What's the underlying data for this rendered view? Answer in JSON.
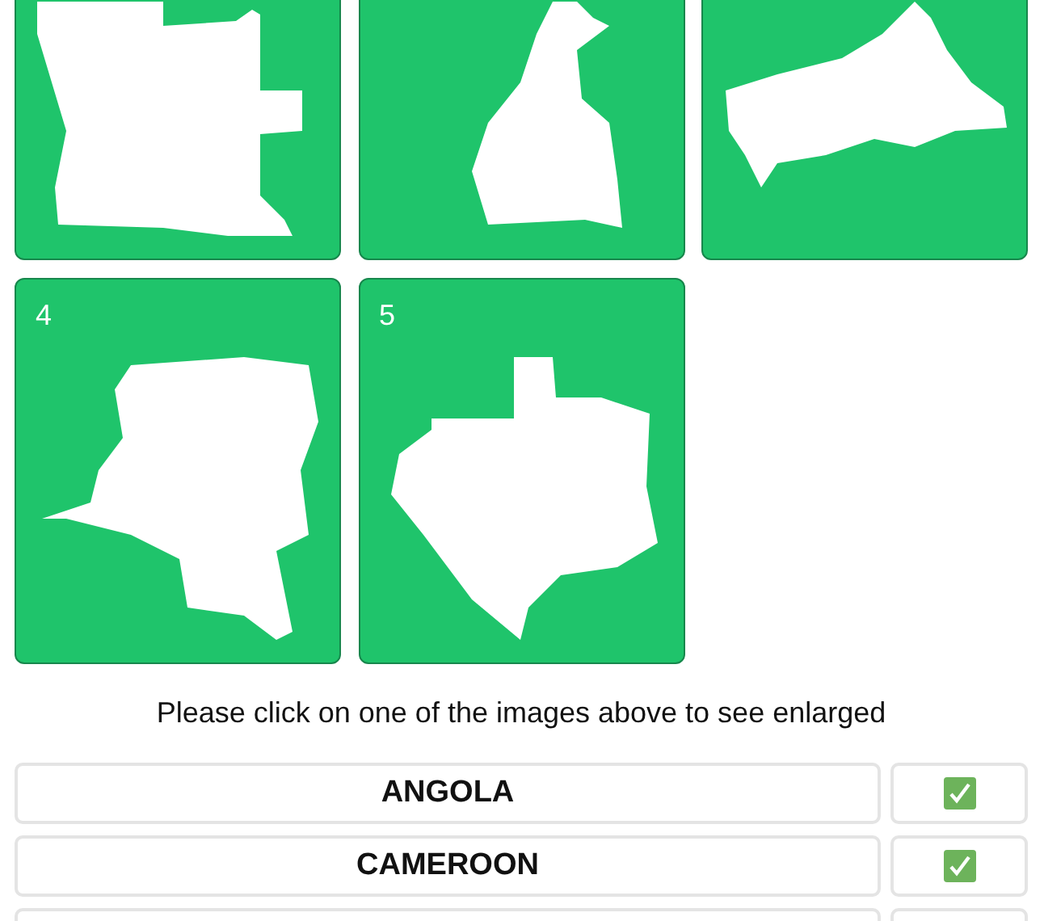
{
  "cards": [
    {
      "kind": "angola"
    },
    {
      "kind": "cameroon"
    },
    {
      "kind": "car"
    },
    {
      "number": "4",
      "kind": "drc"
    },
    {
      "number": "5",
      "kind": "gabon"
    }
  ],
  "prompt": "Please click on one of the images above to see enlarged",
  "answers": [
    {
      "name": "ANGOLA",
      "correct": true
    },
    {
      "name": "CAMEROON",
      "correct": true
    }
  ]
}
